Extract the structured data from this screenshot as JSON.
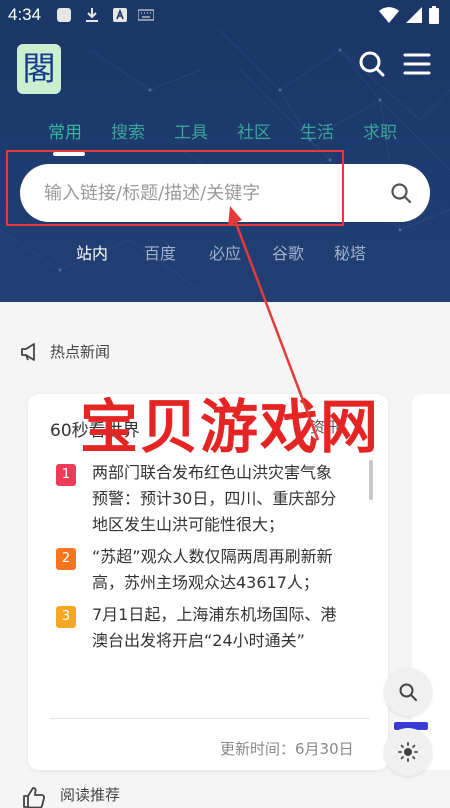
{
  "status_bar": {
    "time": "4:34",
    "icons_left": [
      "app-icon",
      "download-icon",
      "a-icon",
      "keyboard-icon"
    ],
    "icons_right": [
      "wifi-icon",
      "signal-icon",
      "battery-icon"
    ]
  },
  "header": {
    "logo_text": "閣",
    "tabs": [
      "常用",
      "搜索",
      "工具",
      "社区",
      "生活",
      "求职"
    ],
    "active_tab": "常用"
  },
  "search": {
    "placeholder": "输入链接/标题/描述/关键字"
  },
  "engines": {
    "items": [
      "站内",
      "百度",
      "必应",
      "谷歌",
      "秘塔"
    ],
    "active": "站内"
  },
  "hot_news": {
    "section_title": "热点新闻",
    "card_title": "60秒看世界",
    "card_tag": "资讯",
    "items": [
      {
        "num": "1",
        "color": "#ef3b5a",
        "text": "两部门联合发布红色山洪灾害气象预警：预计30日，四川、重庆部分地区发生山洪可能性很大；"
      },
      {
        "num": "2",
        "color": "#f5761f",
        "text": "“苏超”观众人数仅隔两周再刷新新高，苏州主场观众达43617人；"
      },
      {
        "num": "3",
        "color": "#f5a623",
        "text": "7月1日起，上海浦东机场国际、港澳台出发将开启“24小时通关”"
      }
    ],
    "updated": "更新时间：6月30日"
  },
  "watermark": "宝贝游戏网",
  "next_section": "阅读推荐",
  "colors": {
    "header_bg": "#1b3767",
    "tab_color": "#3aa59a",
    "annotation_red": "#e53a3a"
  }
}
